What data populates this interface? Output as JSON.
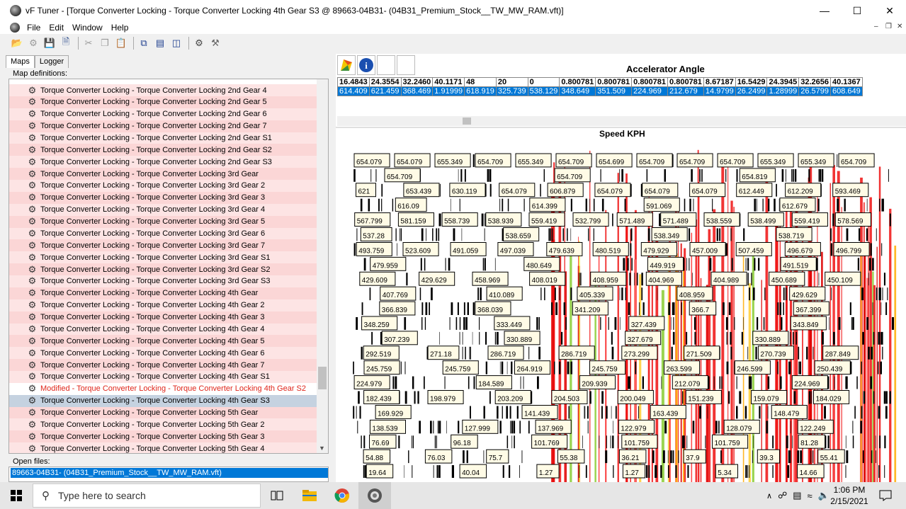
{
  "window": {
    "title": "vF Tuner  - [Torque Converter Locking - Torque Converter Locking 4th Gear S3 @ 89663-04B31- (04B31_Premium_Stock__TW_MW_RAM.vft)]"
  },
  "menu": [
    "File",
    "Edit",
    "Window",
    "Help"
  ],
  "left_panel": {
    "tabs": [
      "Maps",
      "Logger"
    ],
    "map_definitions_label": "Map definitions:",
    "items": [
      {
        "label": "Torque Converter Locking - Torque Converter Locking 2nd Gear 4",
        "state": "normal"
      },
      {
        "label": "Torque Converter Locking - Torque Converter Locking 2nd Gear 5",
        "state": "normal"
      },
      {
        "label": "Torque Converter Locking - Torque Converter Locking 2nd Gear 6",
        "state": "normal"
      },
      {
        "label": "Torque Converter Locking - Torque Converter Locking 2nd Gear 7",
        "state": "normal"
      },
      {
        "label": "Torque Converter Locking - Torque Converter Locking 2nd Gear S1",
        "state": "normal"
      },
      {
        "label": "Torque Converter Locking - Torque Converter Locking 2nd Gear S2",
        "state": "normal"
      },
      {
        "label": "Torque Converter Locking - Torque Converter Locking 2nd Gear S3",
        "state": "normal"
      },
      {
        "label": "Torque Converter Locking - Torque Converter Locking 3rd Gear",
        "state": "normal"
      },
      {
        "label": "Torque Converter Locking - Torque Converter Locking 3rd Gear 2",
        "state": "normal"
      },
      {
        "label": "Torque Converter Locking - Torque Converter Locking 3rd Gear 3",
        "state": "normal"
      },
      {
        "label": "Torque Converter Locking - Torque Converter Locking 3rd Gear 4",
        "state": "normal"
      },
      {
        "label": "Torque Converter Locking - Torque Converter Locking 3rd Gear 5",
        "state": "normal"
      },
      {
        "label": "Torque Converter Locking - Torque Converter Locking 3rd Gear 6",
        "state": "normal"
      },
      {
        "label": "Torque Converter Locking - Torque Converter Locking 3rd Gear 7",
        "state": "normal"
      },
      {
        "label": "Torque Converter Locking - Torque Converter Locking 3rd Gear S1",
        "state": "normal"
      },
      {
        "label": "Torque Converter Locking - Torque Converter Locking 3rd Gear S2",
        "state": "normal"
      },
      {
        "label": "Torque Converter Locking - Torque Converter Locking 3rd Gear S3",
        "state": "normal"
      },
      {
        "label": "Torque Converter Locking - Torque Converter Locking 4th Gear",
        "state": "normal"
      },
      {
        "label": "Torque Converter Locking - Torque Converter Locking 4th Gear 2",
        "state": "normal"
      },
      {
        "label": "Torque Converter Locking - Torque Converter Locking 4th Gear 3",
        "state": "normal"
      },
      {
        "label": "Torque Converter Locking - Torque Converter Locking 4th Gear 4",
        "state": "normal"
      },
      {
        "label": "Torque Converter Locking - Torque Converter Locking 4th Gear 5",
        "state": "normal"
      },
      {
        "label": "Torque Converter Locking - Torque Converter Locking 4th Gear 6",
        "state": "normal"
      },
      {
        "label": "Torque Converter Locking - Torque Converter Locking 4th Gear 7",
        "state": "normal"
      },
      {
        "label": "Torque Converter Locking - Torque Converter Locking 4th Gear S1",
        "state": "normal"
      },
      {
        "label": "Modified - Torque Converter Locking - Torque Converter Locking 4th Gear S2",
        "state": "modified"
      },
      {
        "label": "Torque Converter Locking - Torque Converter Locking 4th Gear S3",
        "state": "selected"
      },
      {
        "label": "Torque Converter Locking - Torque Converter Locking 5th Gear",
        "state": "normal"
      },
      {
        "label": "Torque Converter Locking - Torque Converter Locking 5th Gear 2",
        "state": "normal"
      },
      {
        "label": "Torque Converter Locking - Torque Converter Locking 5th Gear 3",
        "state": "normal"
      },
      {
        "label": "Torque Converter Locking - Torque Converter Locking 5th Gear 4",
        "state": "normal"
      }
    ],
    "open_files_label": "Open files:",
    "open_files": [
      "89663-04B31- (04B31_Premium_Stock__TW_MW_RAM.vft)"
    ]
  },
  "map_view": {
    "x_axis_title": "Accelerator Angle",
    "x_axis_values": [
      "16.4843",
      "24.3554",
      "32.2460",
      "40.1171",
      "48",
      "20",
      "0",
      "0.800781",
      "0.800781",
      "0.800781",
      "0.800781",
      "8.67187",
      "16.5429",
      "24.3945",
      "32.2656",
      "40.1367"
    ],
    "data_row": [
      "614.409",
      "621.459",
      "368.469",
      "1.91999",
      "618.919",
      "325.739",
      "538.129",
      "348.649",
      "351.509",
      "224.969",
      "212.679",
      "14.9799",
      "26.2499",
      "1.28999",
      "26.5799",
      "608.649"
    ],
    "chart_title": "Speed KPH",
    "speed_rows": [
      [
        "654.079",
        "654.079",
        "655.349",
        "654.709",
        "655.349",
        "654.709",
        "654.699",
        "654.709",
        "654.709",
        "654.709",
        "655.349",
        "655.349",
        "654.709"
      ],
      [
        "654.709",
        "654.709",
        "654.819"
      ],
      [
        "621",
        "653.439",
        "630.119",
        "654.079",
        "606.879",
        "654.079",
        "654.079",
        "654.079",
        "612.449",
        "612.209",
        "593.469"
      ],
      [
        "616.09",
        "614.399",
        "591.069",
        "612.679"
      ],
      [
        "567.799",
        "581.159",
        "558.739",
        "538.939",
        "559.419",
        "532.799",
        "571.489",
        "571.489",
        "538.559",
        "538.499",
        "559.419",
        "578.569"
      ],
      [
        "537.28",
        "538.659",
        "538.349",
        "538.719"
      ],
      [
        "493.759",
        "523.609",
        "491.059",
        "497.039",
        "479.639",
        "480.519",
        "479.929",
        "457.009",
        "507.459",
        "496.679",
        "496.799"
      ],
      [
        "479.959",
        "480.649",
        "449.919",
        "491.519"
      ],
      [
        "429.609",
        "429.629",
        "458.969",
        "408.019",
        "408.959",
        "404.969",
        "404.989",
        "450.689",
        "450.109"
      ],
      [
        "407.769",
        "410.089",
        "405.339",
        "408.959",
        "429.629"
      ],
      [
        "366.839",
        "368.039",
        "341.209",
        "366.7",
        "367.399"
      ],
      [
        "348.259",
        "333.449",
        "327.439",
        "343.849"
      ],
      [
        "307.239",
        "330.889",
        "327.679",
        "330.889"
      ],
      [
        "292.519",
        "271.18",
        "286.719",
        "286.719",
        "273.299",
        "271.509",
        "270.739",
        "287.849"
      ],
      [
        "245.759",
        "245.759",
        "264.919",
        "245.759",
        "263.599",
        "246.599",
        "250.439"
      ],
      [
        "224.979",
        "184.589",
        "209.939",
        "212.079",
        "224.969"
      ],
      [
        "182.439",
        "198.979",
        "203.209",
        "204.503",
        "200.049",
        "151.239",
        "159.079",
        "184.029"
      ],
      [
        "169.929",
        "141.439",
        "163.439",
        "148.479"
      ],
      [
        "138.539",
        "127.999",
        "137.969",
        "122.979",
        "128.079",
        "122.249"
      ],
      [
        "76.69",
        "96.18",
        "101.769",
        "101.759",
        "101.759",
        "81.28"
      ],
      [
        "54.88",
        "76.03",
        "75.7",
        "55.38",
        "36.21",
        "37.9",
        "39.3",
        "55.41"
      ],
      [
        "19.64",
        "40.04",
        "1.27",
        "1.27",
        "5.34",
        "14.66"
      ]
    ]
  },
  "taskbar": {
    "search_placeholder": "Type here to search",
    "time": "1:06 PM",
    "date": "2/15/2021"
  }
}
